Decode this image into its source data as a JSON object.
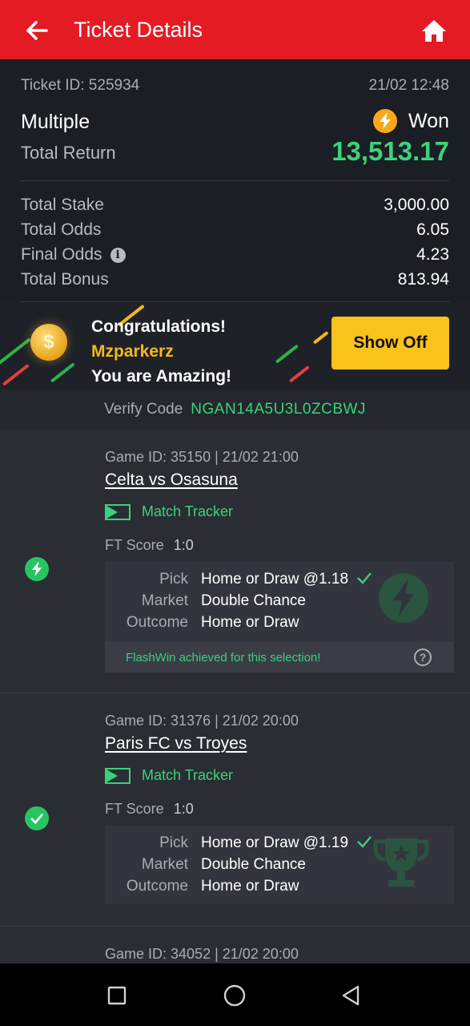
{
  "header": {
    "title": "Ticket Details",
    "back_icon": "arrow-left-icon",
    "home_icon": "home-icon",
    "color": "#e41b23"
  },
  "ticket": {
    "id_label": "Ticket ID: 525934",
    "date": "21/02 12:48",
    "type": "Multiple",
    "status": "Won",
    "total_return_label": "Total Return",
    "total_return": "13,513.17",
    "rows": [
      {
        "label": "Total Stake",
        "value": "3,000.00"
      },
      {
        "label": "Total Odds",
        "value": "6.05"
      },
      {
        "label": "Final Odds",
        "value": "4.23"
      },
      {
        "label": "Total Bonus",
        "value": "813.94"
      }
    ]
  },
  "banner": {
    "line1": "Congratulations!",
    "username": "Mzparkerz",
    "line3": "You are Amazing!",
    "button": "Show Off"
  },
  "verify": {
    "label": "Verify Code",
    "code": "NGAN14A5U3L0ZCBWJ"
  },
  "games": [
    {
      "meta": "Game ID: 35150 | 21/02 21:00",
      "title": "Celta vs Osasuna",
      "tracker": "Match Tracker",
      "ft_label": "FT Score",
      "ft_score": "1:0",
      "status_icon": "flash-icon",
      "pick_label": "Pick",
      "pick": "Home or Draw @1.18",
      "market_label": "Market",
      "market": "Double Chance",
      "outcome_label": "Outcome",
      "outcome": "Home or Draw",
      "flash_note": "FlashWin achieved for this selection!"
    },
    {
      "meta": "Game ID: 31376 | 21/02 20:00",
      "title": "Paris FC vs Troyes",
      "tracker": "Match Tracker",
      "ft_label": "FT Score",
      "ft_score": "1:0",
      "status_icon": "check-circle-icon",
      "pick_label": "Pick",
      "pick": "Home or Draw @1.19",
      "market_label": "Market",
      "market": "Double Chance",
      "outcome_label": "Outcome",
      "outcome": "Home or Draw"
    },
    {
      "meta": "Game ID: 34052 | 21/02 20:00"
    }
  ],
  "colors": {
    "win_green": "#3bd37a",
    "accent_yellow": "#f9c31a",
    "bg": "#1b1e24"
  }
}
